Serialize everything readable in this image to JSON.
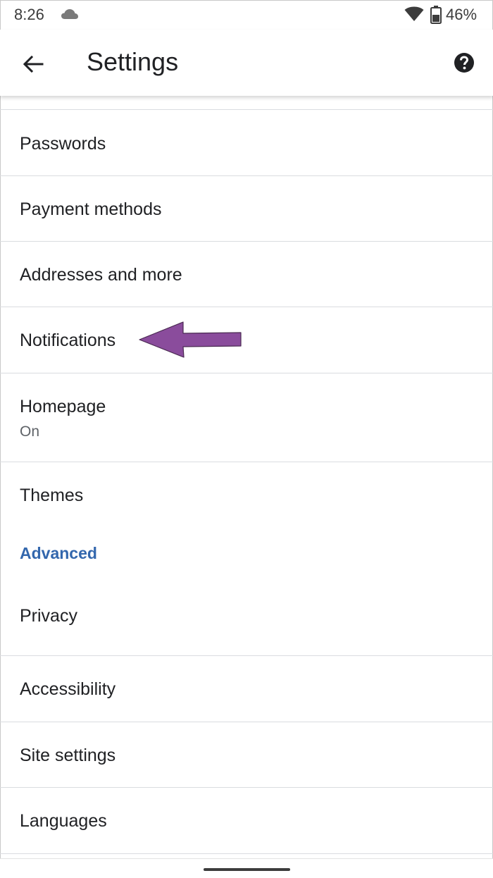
{
  "status_bar": {
    "time": "8:26",
    "battery": "46%",
    "icons": [
      "cloud-icon",
      "wifi-icon",
      "battery-icon"
    ]
  },
  "app_bar": {
    "title": "Settings",
    "back_icon": "arrow-back-icon",
    "help_icon": "help-icon"
  },
  "items": [
    {
      "id": "passwords",
      "title": "Passwords"
    },
    {
      "id": "payment-methods",
      "title": "Payment methods"
    },
    {
      "id": "addresses",
      "title": "Addresses and more"
    },
    {
      "id": "notifications",
      "title": "Notifications"
    },
    {
      "id": "homepage",
      "title": "Homepage",
      "subtitle": "On"
    },
    {
      "id": "themes",
      "title": "Themes"
    }
  ],
  "advanced": {
    "header": "Advanced",
    "items": [
      {
        "id": "privacy",
        "title": "Privacy"
      },
      {
        "id": "accessibility",
        "title": "Accessibility"
      },
      {
        "id": "site-settings",
        "title": "Site settings"
      },
      {
        "id": "languages",
        "title": "Languages"
      }
    ]
  },
  "colors": {
    "section_header": "#3367ad",
    "annotation_arrow": "#8a4c9c",
    "divider": "#dadce0"
  }
}
